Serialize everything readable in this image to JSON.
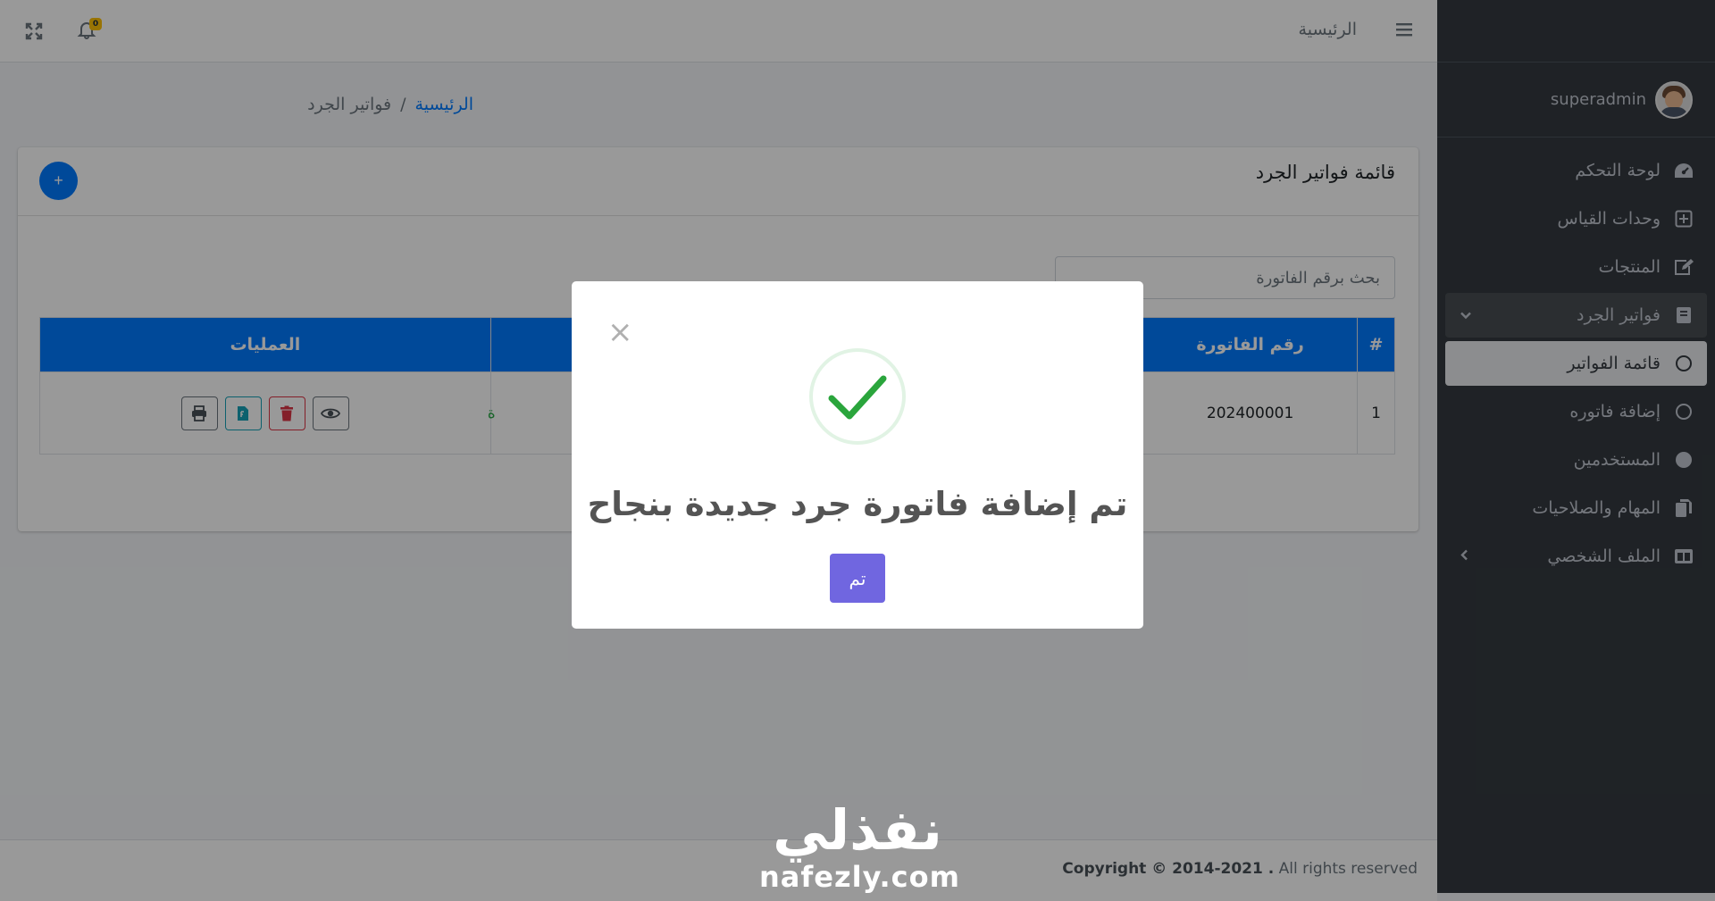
{
  "header": {
    "home_label": "الرئيسية",
    "notification_count": "0"
  },
  "breadcrumb": {
    "home": "الرئيسية",
    "separator": "/",
    "current": "فواتير الجرد"
  },
  "card": {
    "title": "قائمة فواتير الجرد",
    "add_label": "+",
    "search_placeholder": "بحث برقم الفاتورة"
  },
  "table": {
    "headers": [
      "#",
      "رقم الفاتورة",
      "العمليات"
    ],
    "rows": [
      {
        "index": "1",
        "invoice_no": "202400001",
        "status_fragment": "ة"
      }
    ]
  },
  "sidebar": {
    "user": "superadmin",
    "items": [
      {
        "label": "لوحة التحكم",
        "icon": "dashboard-icon"
      },
      {
        "label": "وحدات القياس",
        "icon": "plus-square-icon"
      },
      {
        "label": "المنتجات",
        "icon": "edit-icon"
      },
      {
        "label": "فواتير الجرد",
        "icon": "book-icon"
      },
      {
        "label": "قائمة الفواتير",
        "icon": "circle-icon"
      },
      {
        "label": "إضافة فاتوره",
        "icon": "circle-icon"
      },
      {
        "label": "المستخدمين",
        "icon": "filled-circle-icon"
      },
      {
        "label": "المهام والصلاحيات",
        "icon": "copy-icon"
      },
      {
        "label": "الملف الشخصي",
        "icon": "columns-icon"
      }
    ]
  },
  "footer": {
    "copyright_bold": "Copyright © 2014-2021 .",
    "rights": "All rights reserved"
  },
  "modal": {
    "close": "×",
    "title": "تم إضافة فاتورة جرد جديدة بنجاح",
    "confirm": "تم"
  },
  "watermark": {
    "arabic": "نفذلي",
    "latin": "nafezly.com"
  },
  "colors": {
    "primary": "#007bff",
    "sidebar": "#343a40",
    "success": "#28a745",
    "confirm": "#7066e0"
  }
}
